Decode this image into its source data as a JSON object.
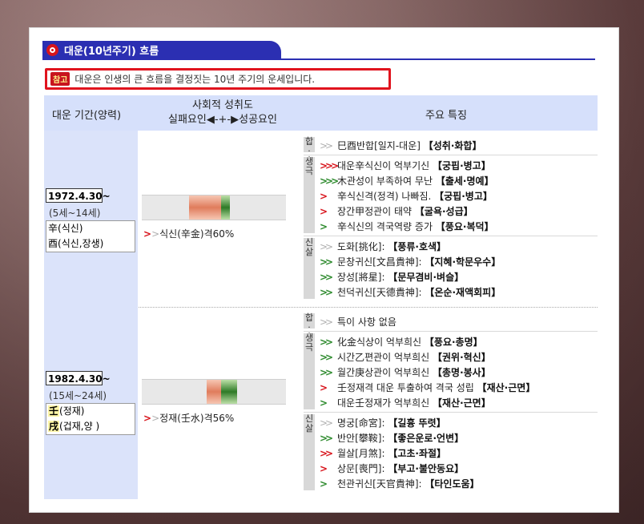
{
  "title": "대운(10년주기) 흐름",
  "note": {
    "badge": "참고",
    "text": "대운은 인생의 큰 흐름을 결정짓는 10년 주기의 운세입니다."
  },
  "header": {
    "period": "대운 기간(양력)",
    "mid_top": "사회적 성취도",
    "mid_bottom": "실패요인◀-+-▶성공요인",
    "features": "주요 특징"
  },
  "label_hap": "합\n·\n충",
  "label_saeng": "생\n극",
  "label_sinsal": "신\n살",
  "periods": [
    {
      "date": "1972.4.30~",
      "age": "(5세~14세)",
      "gan_char": "辛",
      "gan_text": "(식신)",
      "ji_char": "酉",
      "ji_text": "(식신,장생)",
      "score": "식신(辛金)격60%",
      "fail_value": 0.22,
      "success_value": 0.06,
      "hap": [
        {
          "chev": "gray",
          "text": "巳酉반합[일지-대운] ",
          "tag": "【성취·화합】"
        }
      ],
      "saeng": [
        {
          "chev": "red3",
          "text": "대운辛식신이 억부기신 ",
          "tag": "【궁핍·병고】"
        },
        {
          "chev": "green3",
          "text": "木관성이 부족하여 무난 ",
          "tag": "【출세·명예】"
        },
        {
          "chev": "red1",
          "text": "辛식신격(정격) 나빠짐. ",
          "tag": "【궁핍·병고】"
        },
        {
          "chev": "red1",
          "text": "장간甲정관이 태약 ",
          "tag": "【굴욕·성급】"
        },
        {
          "chev": "green1",
          "text": "辛식신의 격국역량 증가 ",
          "tag": "【풍요·복덕】"
        }
      ],
      "sinsal": [
        {
          "chev": "gray2",
          "text": "도화[挑化]: ",
          "tag": "【풍류·호색】"
        },
        {
          "chev": "green2",
          "text": "문창귀신[文昌貴神]: ",
          "tag": "【지혜·학문우수】"
        },
        {
          "chev": "green2",
          "text": "장성[將星]: ",
          "tag": "【문무겸비·벼슬】"
        },
        {
          "chev": "green2",
          "text": "천덕귀신[天德貴神]: ",
          "tag": "【온순·재액회피】"
        }
      ]
    },
    {
      "date": "1982.4.30~",
      "age": "(15세~24세)",
      "gan_char": "壬",
      "gan_text": "(정재)",
      "ji_char": "戌",
      "ji_text": "(겁재,양 )",
      "score": "정재(壬水)격56%",
      "fail_value": 0.1,
      "success_value": 0.11,
      "hap": [
        {
          "chev": "gray",
          "text": "특이 사항 없음",
          "tag": ""
        }
      ],
      "saeng": [
        {
          "chev": "green2",
          "text": "化金식상이 억부희신 ",
          "tag": "【풍요·총명】"
        },
        {
          "chev": "green2",
          "text": "시간乙편관이 억부희신 ",
          "tag": "【권위·혁신】"
        },
        {
          "chev": "green2",
          "text": "월간庚상관이 억부희신 ",
          "tag": "【총명·봉사】"
        },
        {
          "chev": "red1",
          "text": "壬정재격 대운 투출하여 격국 성립 ",
          "tag": "【재산·근면】"
        },
        {
          "chev": "green1",
          "text": "대운壬정재가 억부희신 ",
          "tag": "【재산·근면】"
        }
      ],
      "sinsal": [
        {
          "chev": "gray2",
          "text": "명궁[命宮]: ",
          "tag": "【길흉 뚜렷】"
        },
        {
          "chev": "green2",
          "text": "반안[攀鞍]: ",
          "tag": "【좋은운로·언변】"
        },
        {
          "chev": "red2",
          "text": "월살[月煞]: ",
          "tag": "【고초·좌절】"
        },
        {
          "chev": "red1",
          "text": "상문[喪門]: ",
          "tag": "【부고·불안동요】"
        },
        {
          "chev": "green1",
          "text": "천관귀신[天官貴神]: ",
          "tag": "【타인도움】"
        }
      ]
    }
  ]
}
